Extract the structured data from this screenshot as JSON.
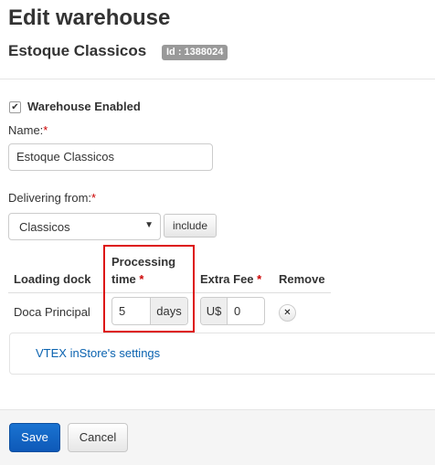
{
  "header": {
    "title": "Edit warehouse",
    "warehouse_name": "Estoque Classicos",
    "id_badge": "Id : 1388024"
  },
  "form": {
    "enabled_label": "Warehouse Enabled",
    "enabled_checked": true,
    "name_label": "Name:",
    "name_value": "Estoque Classicos",
    "required_mark": "*",
    "delivering_label": "Delivering from:",
    "delivering_value": "Classicos",
    "include_button": "include"
  },
  "table": {
    "headers": {
      "loading_dock": "Loading dock",
      "processing_line1": "Processing",
      "processing_line2": "time",
      "extra_fee": "Extra Fee",
      "remove": "Remove"
    },
    "row": {
      "loading_dock": "Doca Principal",
      "processing_value": "5",
      "processing_unit": "days",
      "fee_currency": "U$",
      "fee_value": "0"
    }
  },
  "instore_link": "VTEX inStore's settings",
  "footer": {
    "save_label": "Save",
    "cancel_label": "Cancel"
  },
  "icons": {
    "checkbox": "check-icon",
    "select_caret": "caret-down-icon",
    "remove": "close-icon"
  },
  "colors": {
    "primary": "#0e59b8",
    "required": "#cc0000",
    "highlight": "#dd1111",
    "link": "#0b63b0",
    "badge": "#999999"
  }
}
